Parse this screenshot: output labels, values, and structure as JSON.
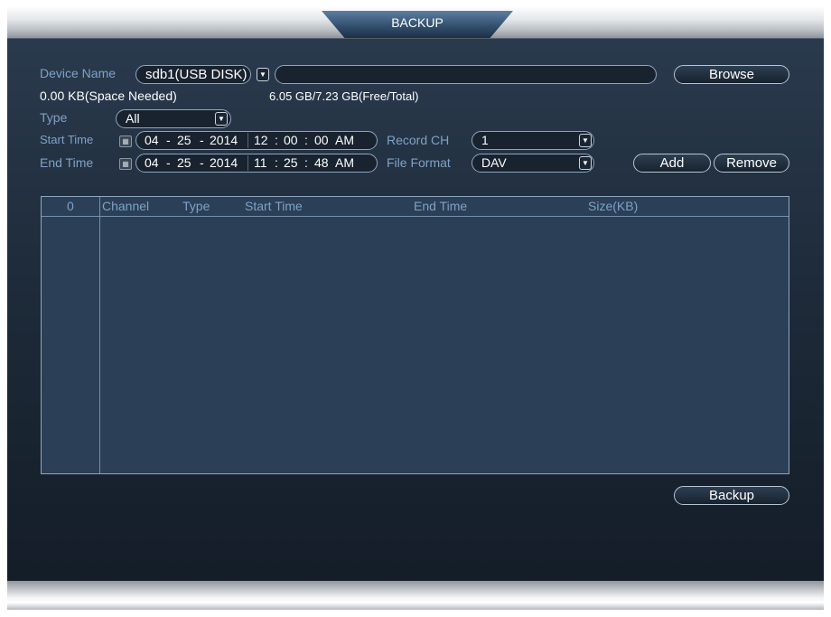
{
  "window": {
    "title": "BACKUP"
  },
  "device": {
    "label": "Device Name",
    "selected": "sdb1(USB DISK)",
    "path_value": "",
    "browse_label": "Browse",
    "space_needed": "0.00 KB(Space Needed)",
    "free_total": "6.05 GB/7.23 GB(Free/Total)"
  },
  "type": {
    "label": "Type",
    "selected": "All"
  },
  "start_time": {
    "label": "Start Time",
    "month": "04",
    "day": "25",
    "year": "2014",
    "hour": "12",
    "minute": "00",
    "second": "00",
    "ampm": "AM"
  },
  "end_time": {
    "label": "End Time",
    "month": "04",
    "day": "25",
    "year": "2014",
    "hour": "11",
    "minute": "25",
    "second": "48",
    "ampm": "AM"
  },
  "record_ch": {
    "label": "Record CH",
    "selected": "1"
  },
  "file_format": {
    "label": "File Format",
    "selected": "DAV"
  },
  "buttons": {
    "add": "Add",
    "remove": "Remove",
    "backup": "Backup"
  },
  "separators": {
    "date": "-",
    "time": ":"
  },
  "table": {
    "columns": [
      "0",
      "Channel",
      "Type",
      "Start Time",
      "End Time",
      "Size(KB)"
    ],
    "rows": []
  },
  "colors": {
    "label": "#7fa2c6",
    "value": "#ffffff",
    "panel": "#2b3f56",
    "title_tab": "#33506f"
  },
  "icons": {
    "dropdown": "caret-down-icon",
    "calendar": "calendar-icon"
  }
}
